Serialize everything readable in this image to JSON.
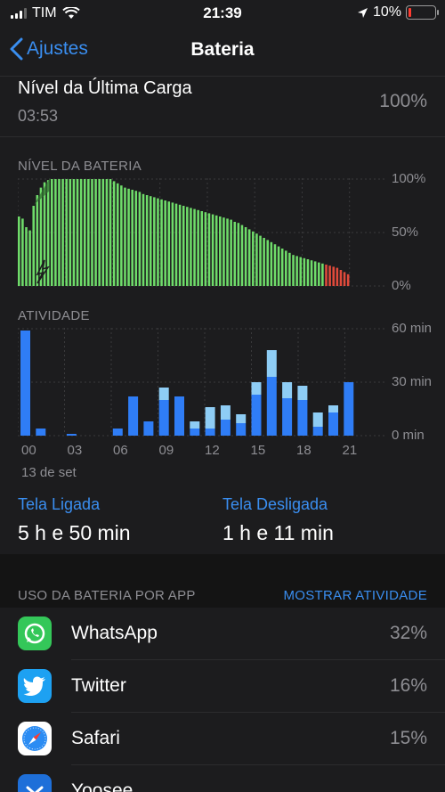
{
  "status": {
    "carrier": "TIM",
    "time": "21:39",
    "battery": "10%"
  },
  "nav": {
    "back_label": "Ajustes",
    "title": "Bateria"
  },
  "last_charge": {
    "title": "Nível da Última Carga",
    "time": "03:53",
    "value": "100%"
  },
  "battery_chart": {
    "label": "NÍVEL DA BATERIA",
    "y_ticks": [
      "100%",
      "50%",
      "0%"
    ],
    "levels": [
      65,
      63,
      55,
      52,
      75,
      85,
      92,
      97,
      99,
      100,
      100,
      100,
      100,
      100,
      100,
      100,
      100,
      100,
      100,
      100,
      100,
      100,
      100,
      100,
      100,
      100,
      98,
      96,
      94,
      92,
      91,
      90,
      89,
      88,
      86,
      85,
      84,
      83,
      82,
      81,
      80,
      79,
      78,
      77,
      76,
      75,
      74,
      73,
      72,
      71,
      70,
      69,
      68,
      67,
      66,
      65,
      64,
      63,
      62,
      60,
      59,
      57,
      55,
      53,
      51,
      49,
      47,
      45,
      43,
      41,
      39,
      37,
      35,
      33,
      31,
      29,
      28,
      27,
      26,
      25,
      24,
      23,
      22,
      21,
      20,
      19,
      18,
      17,
      15,
      13,
      11
    ],
    "red_threshold": 20,
    "colors": {
      "green": "#6fdc6a",
      "red": "#e04a3b",
      "grid": "#3a3a3c"
    }
  },
  "activity_chart": {
    "label": "ATIVIDADE",
    "y_ticks": [
      "60 min",
      "30 min",
      "0 min"
    ],
    "x_ticks": [
      "00",
      "03",
      "06",
      "09",
      "12",
      "15",
      "18",
      "21"
    ],
    "date_label": "13 de set",
    "screen_on": [
      59,
      4,
      0,
      1,
      0,
      0,
      4,
      22,
      8,
      20,
      22,
      4,
      4,
      9,
      7,
      23,
      33,
      21,
      20,
      5,
      13,
      30
    ],
    "screen_off": [
      0,
      0,
      0,
      0,
      0,
      0,
      0,
      0,
      0,
      7,
      0,
      4,
      12,
      8,
      5,
      7,
      15,
      9,
      8,
      8,
      4,
      0
    ],
    "colors": {
      "on": "#2f7df6",
      "off": "#8ecdf5"
    }
  },
  "stats": {
    "on_label": "Tela Ligada",
    "on_value": "5 h e 50 min",
    "off_label": "Tela Desligada",
    "off_value": "1 h e 11 min"
  },
  "usage": {
    "header": "USO DA BATERIA POR APP",
    "action": "MOSTRAR ATIVIDADE",
    "apps": [
      {
        "name": "WhatsApp",
        "percent": "32%",
        "icon": "whatsapp-icon",
        "color": "#34c759"
      },
      {
        "name": "Twitter",
        "percent": "16%",
        "icon": "twitter-icon",
        "color": "#1da1f2"
      },
      {
        "name": "Safari",
        "percent": "15%",
        "icon": "safari-icon",
        "color": "#ffffff"
      },
      {
        "name": "Yoosee",
        "percent": "",
        "icon": "yoosee-icon",
        "color": "#1e6fd9"
      }
    ]
  }
}
